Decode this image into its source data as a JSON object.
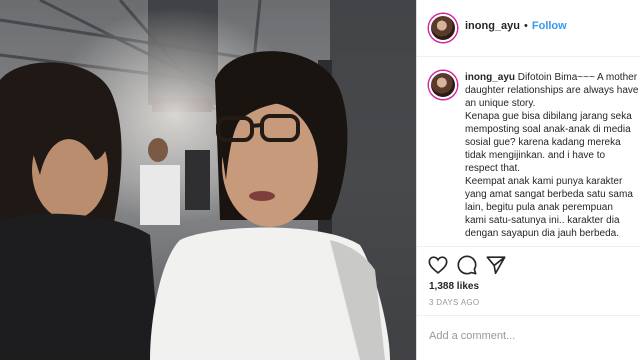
{
  "header": {
    "username": "inong_ayu",
    "separator": "•",
    "follow_label": "Follow"
  },
  "post": {
    "username": "inong_ayu",
    "caption_first": "Difotoin Bima~~~ A mother - daughter relationships are always have an unique story.",
    "caption_lines": [
      "Kenapa gue bisa dibilang jarang seka",
      "memposting soal anak-anak di media",
      "sosial gue? karena kadang mereka",
      "tidak mengijinkan. and i have to",
      "respect that.",
      "Keempat anak kami punya karakter",
      "yang amat sangat berbeda satu sama",
      "lain, begitu pula anak perempuan",
      "kami satu-satunya ini.. karakter dia",
      "dengan sayapun dia jauh berbeda."
    ]
  },
  "actions": {
    "icons": [
      "heart-icon",
      "comment-icon",
      "share-icon"
    ],
    "likes": "1,388 likes",
    "time": "3 DAYS AGO"
  },
  "comment_box": {
    "placeholder": "Add a comment..."
  },
  "colors": {
    "link": "#3897f0",
    "text": "#262626",
    "muted": "#999999",
    "border": "#efefef"
  }
}
